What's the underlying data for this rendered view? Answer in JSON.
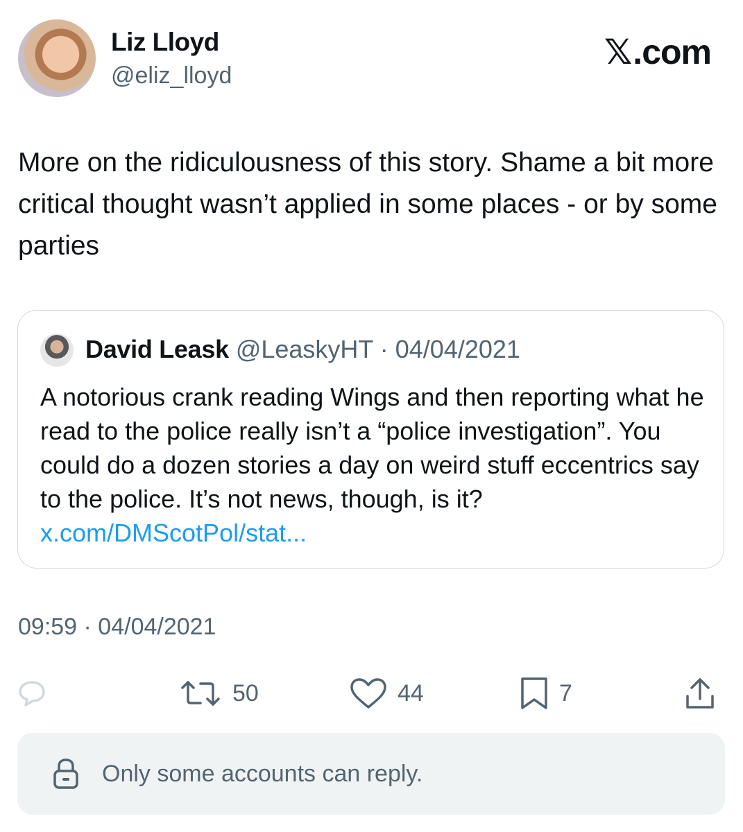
{
  "author": {
    "name": "Liz Lloyd",
    "handle": "@eliz_lloyd"
  },
  "brand": {
    "x": "𝕏",
    "suffix": ".com"
  },
  "tweet": {
    "text": "More on the ridiculousness of this story. Shame a bit more critical thought wasn’t applied in some places - or by some parties",
    "timestamp": "09:59 · 04/04/2021"
  },
  "quoted": {
    "name": "David Leask",
    "handle_date": "@LeaskyHT · 04/04/2021",
    "text": "A notorious crank reading Wings and then reporting what he read to the police really isn’t a “police investigation”.  You could do a dozen stories a day on weird stuff eccentrics  say to the police. It’s not news, though, is it? ",
    "link": "x.com/DMScotPol/stat..."
  },
  "actions": {
    "retweets": "50",
    "likes": "44",
    "bookmarks": "7",
    "reply_icon": "reply-icon",
    "retweet_icon": "retweet-icon",
    "like_icon": "heart-icon",
    "bookmark_icon": "bookmark-icon",
    "share_icon": "share-icon"
  },
  "reply_restriction": {
    "text": "Only some accounts can reply.",
    "icon": "lock-icon"
  },
  "colors": {
    "text": "#0f1419",
    "secondary": "#536471",
    "link": "#1d9bf0",
    "reply_box": "#eff3f4",
    "reply_icon": "#cfd9de"
  }
}
